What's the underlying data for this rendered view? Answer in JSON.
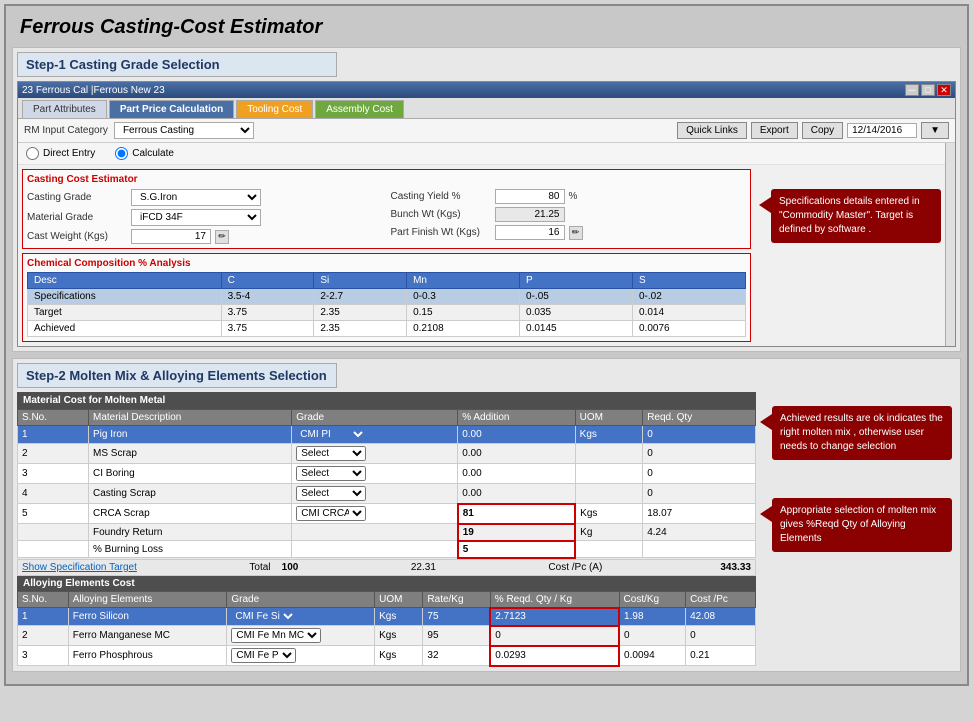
{
  "app": {
    "title": "Ferrous Casting-Cost Estimator"
  },
  "step1": {
    "header": "Step-1   Casting Grade Selection"
  },
  "step2": {
    "header": "Step-2   Molten Mix & Alloying Elements Selection"
  },
  "window": {
    "title": "23 Ferrous Cal |Ferrous New 23"
  },
  "tabs": [
    {
      "label": "Part Attributes",
      "state": "default"
    },
    {
      "label": "Part Price Calculation",
      "state": "active"
    },
    {
      "label": "Tooling Cost",
      "state": "orange"
    },
    {
      "label": "Assembly Cost",
      "state": "green"
    }
  ],
  "toolbar": {
    "rm_label": "RM Input Category",
    "rm_value": "Ferrous Casting",
    "quick_links": "Quick Links",
    "export": "Export",
    "copy": "Copy",
    "date": "12/14/2016"
  },
  "radio": {
    "direct_entry": "Direct Entry",
    "calculate": "Calculate"
  },
  "cce": {
    "title": "Casting Cost Estimator",
    "casting_grade_label": "Casting Grade",
    "casting_grade_value": "S.G.Iron",
    "material_grade_label": "Material Grade",
    "material_grade_value": "iFCD 34F",
    "cast_weight_label": "Cast Weight (Kgs)",
    "cast_weight_value": "17",
    "casting_yield_label": "Casting Yield %",
    "casting_yield_value": "80",
    "casting_yield_unit": "%",
    "bunch_wt_label": "Bunch Wt (Kgs)",
    "bunch_wt_value": "21.25",
    "part_finish_label": "Part Finish Wt (Kgs)",
    "part_finish_value": "16"
  },
  "tooltip1": {
    "text": "Specifications  details entered in \"Commodity Master\". Target is defined by software ."
  },
  "chem": {
    "title": "Chemical Composition % Analysis",
    "columns": [
      "Desc",
      "C",
      "Si",
      "Mn",
      "P",
      "S"
    ],
    "rows": [
      {
        "desc": "Specifications",
        "c": "3.5-4",
        "si": "2-2.7",
        "mn": "0-0.3",
        "p": "0-.05",
        "s": "0-.02",
        "highlight": true
      },
      {
        "desc": "Target",
        "c": "3.75",
        "si": "2.35",
        "mn": "0.15",
        "p": "0.035",
        "s": "0.014"
      },
      {
        "desc": "Achieved",
        "c": "3.75",
        "si": "2.35",
        "mn": "0.2108",
        "p": "0.0145",
        "s": "0.0076"
      }
    ]
  },
  "molten": {
    "section_title": "Material Cost for Molten Metal",
    "columns": [
      "S.No.",
      "Material Description",
      "Grade",
      "% Addition",
      "UOM",
      "Reqd. Qty"
    ],
    "rows": [
      {
        "sno": "1",
        "desc": "Pig Iron",
        "grade": "CMI PI",
        "pct": "0.00",
        "uom": "Kgs",
        "qty": "0",
        "header": true
      },
      {
        "sno": "2",
        "desc": "MS Scrap",
        "grade": "Select",
        "pct": "0.00",
        "uom": "",
        "qty": "0"
      },
      {
        "sno": "3",
        "desc": "CI Boring",
        "grade": "Select",
        "pct": "0.00",
        "uom": "",
        "qty": "0"
      },
      {
        "sno": "4",
        "desc": "Casting Scrap",
        "grade": "Select",
        "pct": "0.00",
        "uom": "",
        "qty": "0"
      },
      {
        "sno": "5",
        "desc": "CRCA Scrap",
        "grade": "CMI CRCA",
        "pct": "81",
        "uom": "Kgs",
        "qty": "18.07"
      },
      {
        "sno": "",
        "desc": "Foundry Return",
        "grade": "",
        "pct": "19",
        "uom": "Kg",
        "qty": "4.24"
      },
      {
        "sno": "",
        "desc": "% Burning Loss",
        "grade": "",
        "pct": "5",
        "uom": "",
        "qty": ""
      }
    ],
    "show_spec_target": "Show Specification Target",
    "total_label": "Total",
    "total_value": "100",
    "total_qty": "22.31",
    "cost_pc_label": "Cost /Pc (A)",
    "cost_pc_value": "343.33"
  },
  "tooltip2": {
    "text": "Achieved results are ok indicates the right molten mix , otherwise user needs to change selection"
  },
  "tooltip3": {
    "text": "Appropriate  selection of molten mix gives %Reqd Qty of Alloying Elements"
  },
  "alloying": {
    "section_title": "Alloying Elements Cost",
    "columns": [
      "S.No.",
      "Alloying Elements",
      "Grade",
      "UOM",
      "Rate/Kg",
      "% Reqd. Qty / Kg",
      "Cost/Kg",
      "Cost /Pc"
    ],
    "rows": [
      {
        "sno": "1",
        "element": "Ferro Silicon",
        "grade": "CMI Fe Si",
        "uom": "Kgs",
        "rate": "75",
        "pct_reqd": "2.7123",
        "cost_kg": "1.98",
        "cost_pc": "42.08",
        "header_row": true
      },
      {
        "sno": "2",
        "element": "Ferro Manganese MC",
        "grade": "CMI Fe Mn MC",
        "uom": "Kgs",
        "rate": "95",
        "pct_reqd": "0",
        "cost_kg": "0",
        "cost_pc": "0"
      },
      {
        "sno": "3",
        "element": "Ferro Phosphrous",
        "grade": "CMI Fe P",
        "uom": "Kgs",
        "rate": "32",
        "pct_reqd": "0.0293",
        "cost_kg": "0.0094",
        "cost_pc": "0.21"
      }
    ]
  }
}
